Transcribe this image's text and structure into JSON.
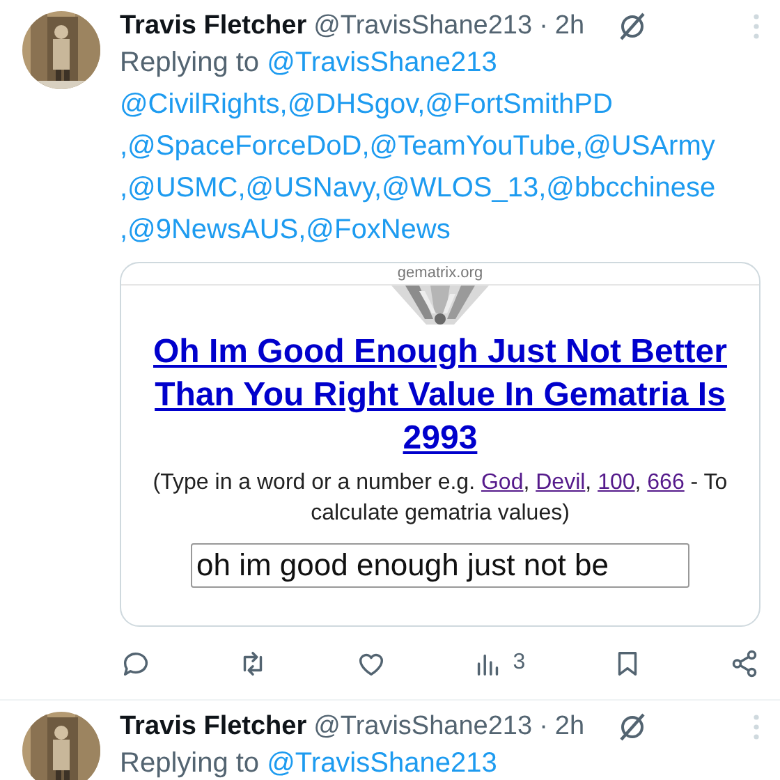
{
  "tweets": [
    {
      "author": "Travis Fletcher",
      "handle": "@TravisShane213",
      "separator": "·",
      "time": "2h",
      "replying_label": "Replying to",
      "reply_to": "@TravisShane213",
      "mention_lines": [
        [
          "@CivilRights",
          ",@DHSgov",
          ",@FortSmithPD"
        ],
        [
          ",@SpaceForceDoD",
          ",@TeamYouTube",
          ",@USArmy"
        ],
        [
          ",@USMC",
          ",@USNavy",
          ",@WLOS_13",
          ",@bbcchinese"
        ],
        [
          ",@9NewsAUS",
          ",@FoxNews"
        ]
      ],
      "card": {
        "site": "gematrix.org",
        "title": "Oh Im Good Enough Just Not Better Than You Right Value In Gematria Is 2993",
        "description": [
          {
            "kind": "text",
            "text": "(Type in a word or a number e.g. "
          },
          {
            "kind": "link",
            "text": "God"
          },
          {
            "kind": "text",
            "text": ", "
          },
          {
            "kind": "link",
            "text": "Devil"
          },
          {
            "kind": "text",
            "text": ", "
          },
          {
            "kind": "link",
            "text": "100"
          },
          {
            "kind": "text",
            "text": ", "
          },
          {
            "kind": "link",
            "text": "666"
          },
          {
            "kind": "text",
            "text": " - To calculate gematria values)"
          }
        ],
        "input_value": "oh im good enough just not be"
      },
      "actions": [
        {
          "kind": "reply"
        },
        {
          "kind": "repost"
        },
        {
          "kind": "like"
        },
        {
          "kind": "views",
          "count": "3"
        },
        {
          "kind": "bookmark"
        },
        {
          "kind": "share"
        }
      ]
    },
    {
      "author": "Travis Fletcher",
      "handle": "@TravisShane213",
      "separator": "·",
      "time": "2h",
      "replying_label": "Replying to",
      "reply_to": "@TravisShane213"
    }
  ]
}
